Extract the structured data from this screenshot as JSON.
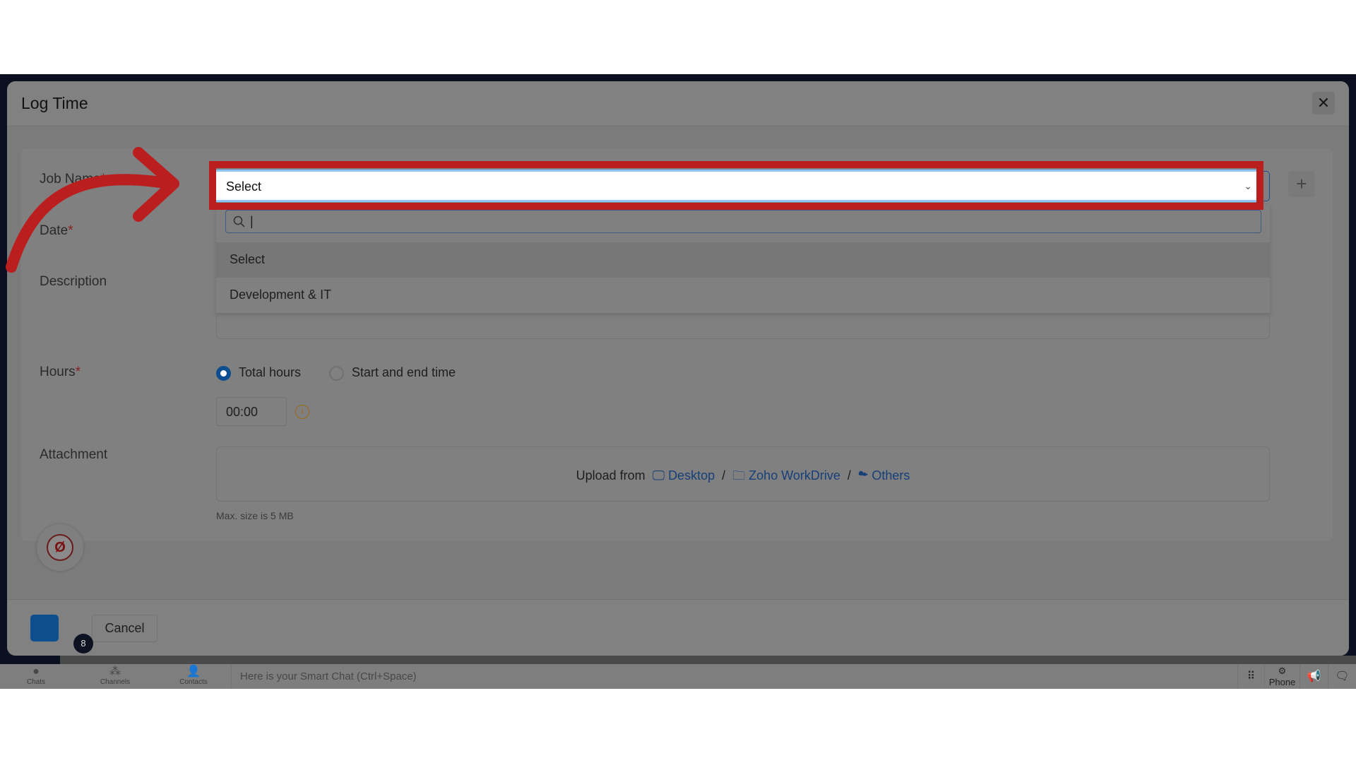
{
  "modal": {
    "title": "Log Time",
    "close_icon": "close-icon"
  },
  "form": {
    "job_name_label": "Job Name",
    "required_mark": "*",
    "job_select_value": "Select",
    "search_value": "|",
    "options": [
      "Select",
      "Development & IT"
    ],
    "date_label": "Date",
    "description_label": "Description",
    "hours_label": "Hours",
    "hours_options": [
      {
        "label": "Total hours",
        "selected": true
      },
      {
        "label": "Start and end time",
        "selected": false
      }
    ],
    "hours_value": "00:00",
    "attachment_label": "Attachment",
    "upload_from": "Upload from",
    "desktop": "Desktop",
    "workdrive": "Zoho WorkDrive",
    "others": "Others",
    "separator": "/",
    "max_size": "Max. size is 5 MB"
  },
  "footer": {
    "cancel": "Cancel",
    "badge_count": "8"
  },
  "bottombar": {
    "chats": "Chats",
    "channels": "Channels",
    "contacts": "Contacts",
    "smart_chat": "Here is your Smart Chat (Ctrl+Space)",
    "phone": "Phone"
  },
  "colors": {
    "highlight": "#bb1e1e",
    "accent": "#0c4e8f",
    "link": "#163f78"
  }
}
